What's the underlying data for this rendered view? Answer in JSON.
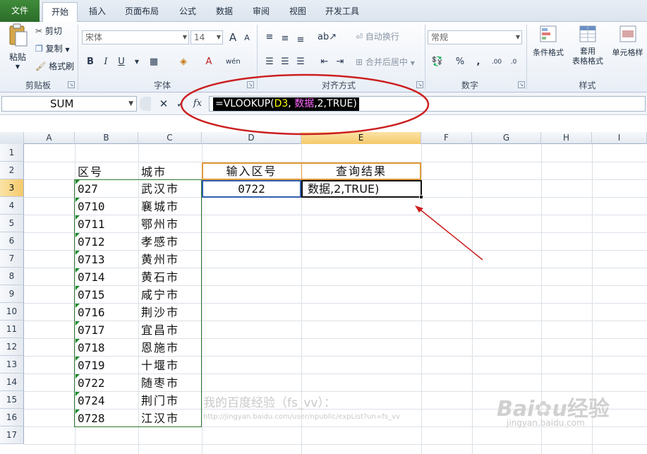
{
  "tabs": [
    "文件",
    "开始",
    "插入",
    "页面布局",
    "公式",
    "数据",
    "审阅",
    "视图",
    "开发工具"
  ],
  "ribbon": {
    "clipboard": {
      "paste": "粘贴",
      "cut": "剪切",
      "copy": "复制",
      "format_painter": "格式刷",
      "label": "剪贴板"
    },
    "font": {
      "name": "宋体",
      "size": "14",
      "label": "字体",
      "bold": "B",
      "italic": "I",
      "underline": "U",
      "grow": "A",
      "shrink": "A"
    },
    "alignment": {
      "wrap": "自动换行",
      "merge": "合并后居中",
      "label": "对齐方式"
    },
    "number": {
      "format": "常规",
      "percent": "%",
      "comma": ",",
      "label": "数字"
    },
    "styles": {
      "conditional": "条件格式",
      "table_format_1": "套用",
      "table_format_2": "表格格式",
      "cell_styles": "单元格样",
      "label": "样式"
    }
  },
  "formula_bar": {
    "name_box": "SUM",
    "fx": "fx",
    "formula_prefix": "=VLOOKUP(",
    "formula_arg1": "D3",
    "formula_sep1": ", ",
    "formula_arg2": "数据",
    "formula_rest": ",2,TRUE)"
  },
  "columns": [
    "A",
    "B",
    "C",
    "D",
    "E",
    "F",
    "G",
    "H",
    "I"
  ],
  "rows": [
    "1",
    "2",
    "3",
    "4",
    "5",
    "6",
    "7",
    "8",
    "9",
    "10",
    "11",
    "12",
    "13",
    "14",
    "15",
    "16",
    "17"
  ],
  "sheet": {
    "header_code": "区号",
    "header_city": "城市",
    "input_header": "输入区号",
    "result_header": "查询结果",
    "input_value": "0722",
    "result_value": "数据,2,TRUE)",
    "table": [
      {
        "code": "027",
        "city": "武汉市"
      },
      {
        "code": "0710",
        "city": "襄城市"
      },
      {
        "code": "0711",
        "city": "鄂州市"
      },
      {
        "code": "0712",
        "city": "孝感市"
      },
      {
        "code": "0713",
        "city": "黄州市"
      },
      {
        "code": "0714",
        "city": "黄石市"
      },
      {
        "code": "0715",
        "city": "咸宁市"
      },
      {
        "code": "0716",
        "city": "荆沙市"
      },
      {
        "code": "0717",
        "city": "宜昌市"
      },
      {
        "code": "0718",
        "city": "恩施市"
      },
      {
        "code": "0719",
        "city": "十堰市"
      },
      {
        "code": "0722",
        "city": "随枣市"
      },
      {
        "code": "0724",
        "city": "荆门市"
      },
      {
        "code": "0728",
        "city": "江汉市"
      }
    ]
  },
  "watermark": {
    "text": "我的百度经验（fs_vv）：",
    "url": "http://jingyan.baidu.com/user/npublic/expList?un=fs_vv",
    "logo": "Bai",
    "logo2": "经验",
    "site": "jingyan.baidu.com"
  },
  "colors": {
    "annotation": "#cc1f1f",
    "active_tab_green": "#2c6d29",
    "selected_header": "#f5c96b"
  }
}
